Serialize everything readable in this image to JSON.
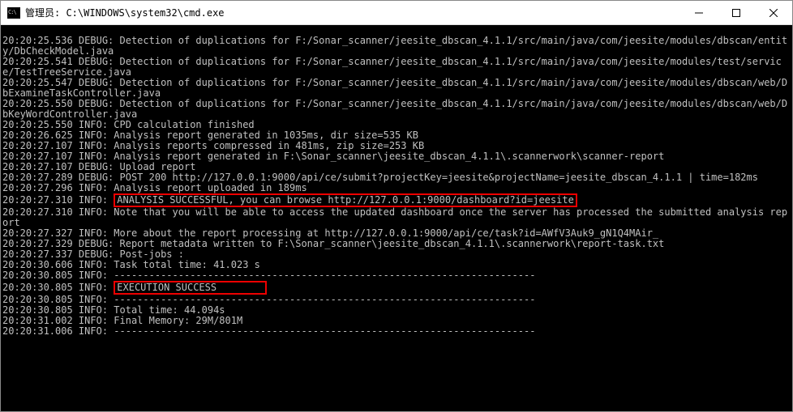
{
  "window": {
    "title": "管理员: C:\\WINDOWS\\system32\\cmd.exe"
  },
  "lines": {
    "l0": "20:20:25.536 DEBUG: Detection of duplications for F:/Sonar_scanner/jeesite_dbscan_4.1.1/src/main/java/com/jeesite/modules/dbscan/entity/DbCheckModel.java",
    "l1": "20:20:25.541 DEBUG: Detection of duplications for F:/Sonar_scanner/jeesite_dbscan_4.1.1/src/main/java/com/jeesite/modules/test/service/TestTreeService.java",
    "l2": "20:20:25.547 DEBUG: Detection of duplications for F:/Sonar_scanner/jeesite_dbscan_4.1.1/src/main/java/com/jeesite/modules/dbscan/web/DbExamineTaskController.java",
    "l3": "20:20:25.550 DEBUG: Detection of duplications for F:/Sonar_scanner/jeesite_dbscan_4.1.1/src/main/java/com/jeesite/modules/dbscan/web/DbKeyWordController.java",
    "l4": "20:20:25.550 INFO: CPD calculation finished",
    "l5": "20:20:26.625 INFO: Analysis report generated in 1035ms, dir size=535 KB",
    "l6": "20:20:27.107 INFO: Analysis reports compressed in 481ms, zip size=253 KB",
    "l7": "20:20:27.107 INFO: Analysis report generated in F:\\Sonar_scanner\\jeesite_dbscan_4.1.1\\.scannerwork\\scanner-report",
    "l8": "20:20:27.107 DEBUG: Upload report",
    "l9": "20:20:27.289 DEBUG: POST 200 http://127.0.0.1:9000/api/ce/submit?projectKey=jeesite&projectName=jeesite_dbscan_4.1.1 | time=182ms",
    "l10": "20:20:27.296 INFO: Analysis report uploaded in 189ms",
    "l11a": "20:20:27.310 INFO: ",
    "l11b": "ANALYSIS SUCCESSFUL, you can browse http://127.0.0.1:9000/dashboard?id=jeesite",
    "l12": "20:20:27.310 INFO: Note that you will be able to access the updated dashboard once the server has processed the submitted analysis report",
    "l13": "20:20:27.327 INFO: More about the report processing at http://127.0.0.1:9000/api/ce/task?id=AWfV3Auk9_gN1Q4MAir_",
    "l14": "20:20:27.329 DEBUG: Report metadata written to F:\\Sonar_scanner\\jeesite_dbscan_4.1.1\\.scannerwork\\report-task.txt",
    "l15": "20:20:27.337 DEBUG: Post-jobs :",
    "l16": "20:20:30.606 INFO: Task total time: 41.023 s",
    "l17": "20:20:30.805 INFO: ------------------------------------------------------------------------",
    "l18a": "20:20:30.805 INFO: ",
    "l18b": "EXECUTION SUCCESS        ",
    "l19": "20:20:30.805 INFO: ------------------------------------------------------------------------",
    "l20": "20:20:30.805 INFO: Total time: 44.094s",
    "l21": "20:20:31.002 INFO: Final Memory: 29M/801M",
    "l22": "20:20:31.006 INFO: ------------------------------------------------------------------------"
  }
}
